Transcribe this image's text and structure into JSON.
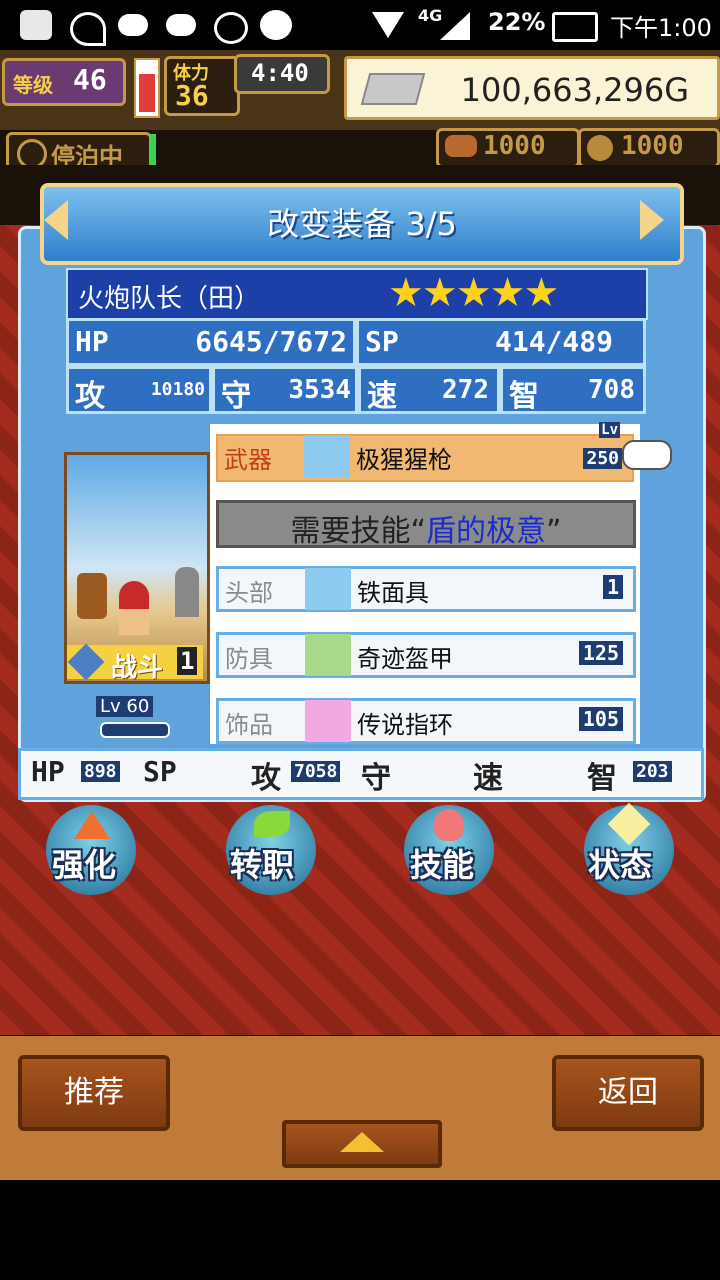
{
  "status_bar": {
    "network": "4G",
    "battery": "22%",
    "time": "下午1:00"
  },
  "hud": {
    "level_label": "等级",
    "level": "46",
    "stamina_label": "体力",
    "stamina": "36",
    "timer": "4:40",
    "gold": "100,663,296G",
    "ship_status": "停泊中",
    "res1": "1000",
    "res2": "1000"
  },
  "modal": {
    "title": "改变装备 3/5",
    "char_name": "火炮队长（田）",
    "stars": 5,
    "stats": {
      "hp_label": "HP",
      "hp": "6645/7672",
      "sp_label": "SP",
      "sp": "414/489",
      "atk_label": "攻",
      "atk": "10180",
      "def_label": "守",
      "def": "3534",
      "spd_label": "速",
      "spd": "272",
      "int_label": "智",
      "int": "708"
    },
    "portrait": {
      "role": "战斗",
      "role_level": "1",
      "lv_label": "Lv",
      "lv": "60"
    },
    "weapon": {
      "label": "武器",
      "name": "极猩猩枪",
      "lv_label": "Lv",
      "lv": "250"
    },
    "required_skill": {
      "prefix": "需要技能“",
      "skill": "盾的极意",
      "suffix": "”"
    },
    "slots": [
      {
        "label": "头部",
        "name": "铁面具",
        "value": "1"
      },
      {
        "label": "防具",
        "name": "奇迹盔甲",
        "value": "125"
      },
      {
        "label": "饰品",
        "name": "传说指环",
        "value": "105"
      }
    ],
    "bonus": {
      "hp_label": "HP",
      "hp": "898",
      "sp_label": "SP",
      "sp": "",
      "atk_label": "攻",
      "atk": "7058",
      "def_label": "守",
      "def": "",
      "spd_label": "速",
      "spd": "",
      "int_label": "智",
      "int": "203"
    }
  },
  "actions": [
    {
      "label": "强化",
      "icon": "arrow-up-icon"
    },
    {
      "label": "转职",
      "icon": "leaf-icon"
    },
    {
      "label": "技能",
      "icon": "flame-icon"
    },
    {
      "label": "状态",
      "icon": "sparkle-icon"
    }
  ],
  "bottom": {
    "recommend": "推荐",
    "back": "返回"
  },
  "colors": {
    "modal_bg": "#5fa3dc",
    "stat_cell": "#2f6fc2",
    "weapon_slot": "#f0b870",
    "skill_blue": "#1b2ccc",
    "wood": "#a8541e"
  }
}
